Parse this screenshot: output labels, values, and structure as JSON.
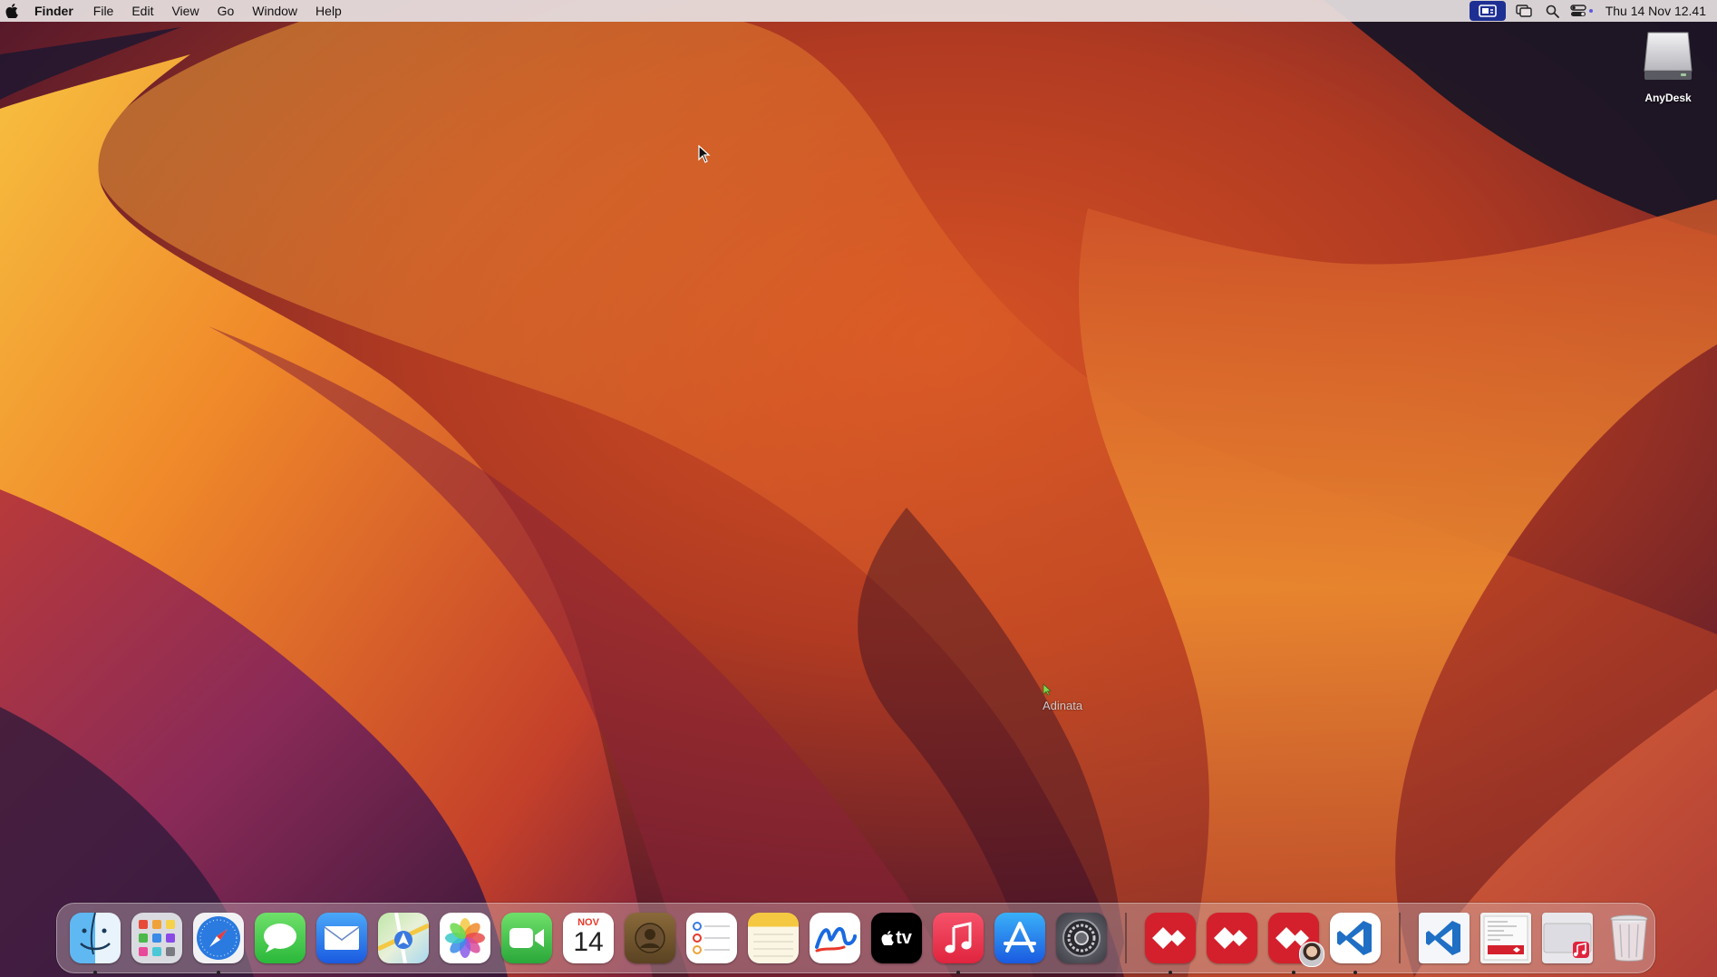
{
  "menubar": {
    "app_name": "Finder",
    "menus": [
      "File",
      "Edit",
      "View",
      "Go",
      "Window",
      "Help"
    ],
    "clock": "Thu 14 Nov  12.41",
    "status_icons": [
      "anydesk-session-icon",
      "screen-mirroring-icon",
      "spotlight-search-icon",
      "control-center-icon"
    ]
  },
  "desktop": {
    "icons": [
      {
        "label": "AnyDesk",
        "icon": "external-drive-icon"
      }
    ],
    "remote_cursor_label": "Adinata"
  },
  "dock": {
    "apps": [
      {
        "name": "Finder",
        "icon": "finder-icon",
        "running": true
      },
      {
        "name": "Launchpad",
        "icon": "launchpad-icon",
        "running": false
      },
      {
        "name": "Safari",
        "icon": "safari-icon",
        "running": true
      },
      {
        "name": "Messages",
        "icon": "messages-icon",
        "running": false
      },
      {
        "name": "Mail",
        "icon": "mail-icon",
        "running": false
      },
      {
        "name": "Maps",
        "icon": "maps-icon",
        "running": false
      },
      {
        "name": "Photos",
        "icon": "photos-icon",
        "running": false
      },
      {
        "name": "FaceTime",
        "icon": "facetime-icon",
        "running": false
      },
      {
        "name": "Calendar",
        "icon": "calendar-icon",
        "running": false,
        "month": "NOV",
        "day": "14"
      },
      {
        "name": "Contacts",
        "icon": "contacts-icon",
        "running": false
      },
      {
        "name": "Reminders",
        "icon": "reminders-icon",
        "running": false
      },
      {
        "name": "Notes",
        "icon": "notes-icon",
        "running": false
      },
      {
        "name": "Freeform",
        "icon": "freeform-icon",
        "running": false
      },
      {
        "name": "TV",
        "icon": "apple-tv-icon",
        "running": false,
        "text": "tv"
      },
      {
        "name": "Music",
        "icon": "music-icon",
        "running": true
      },
      {
        "name": "App Store",
        "icon": "app-store-icon",
        "running": false
      },
      {
        "name": "System Settings",
        "icon": "system-settings-icon",
        "running": false
      }
    ],
    "recent_apps": [
      {
        "name": "AnyDesk",
        "icon": "anydesk-icon",
        "running": true
      },
      {
        "name": "AnyDesk",
        "icon": "anydesk-icon",
        "running": false
      },
      {
        "name": "AnyDesk",
        "icon": "anydesk-icon",
        "running": true
      },
      {
        "name": "Visual Studio Code",
        "icon": "vscode-icon",
        "running": true
      }
    ],
    "documents": [
      {
        "name": "Visual Studio Code",
        "icon": "vscode-doc-icon"
      },
      {
        "name": "Document",
        "icon": "document-preview-icon"
      },
      {
        "name": "Music",
        "icon": "music-doc-icon"
      },
      {
        "name": "Trash",
        "icon": "trash-icon"
      }
    ]
  },
  "colors": {
    "menubar_bg": "#e8e2e2",
    "active_status_bg": "#1e2f94",
    "anydesk_red": "#d4202c",
    "vscode_blue": "#1f6fc5"
  }
}
